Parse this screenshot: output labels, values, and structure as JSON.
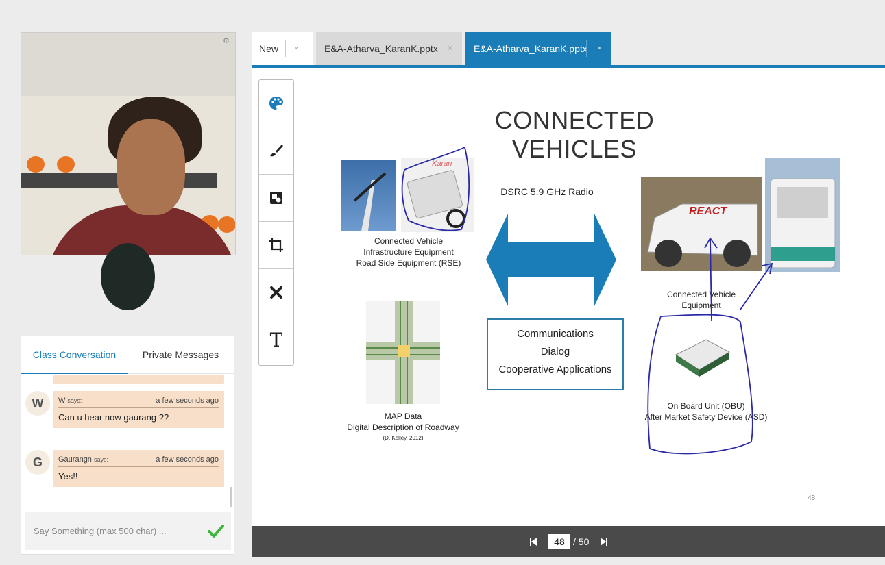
{
  "tabs": {
    "new_label": "New",
    "items": [
      {
        "label": "E&A-Atharva_KaranK.pptx",
        "close": "×"
      },
      {
        "label": "E&A-Atharva_KaranK.pptx",
        "close": "×"
      }
    ]
  },
  "slide": {
    "title": "CONNECTED VEHICLES",
    "rse_caption": [
      "Connected Vehicle",
      "Infrastructure Equipment",
      "Road Side Equipment (RSE)"
    ],
    "rse_watermark": "Karan",
    "dsrc_label": "DSRC 5.9 GHz Radio",
    "comm_box": [
      "Communications",
      "Dialog",
      "Cooperative Applications"
    ],
    "map_caption": [
      "MAP Data",
      "Digital Description of Roadway",
      "(D. Kelley, 2012)"
    ],
    "cve_caption": [
      "Connected Vehicle",
      "Equipment"
    ],
    "truck_logo": "REACT",
    "obu_caption": [
      "On Board Unit (OBU)",
      "After Market Safety Device (ASD)"
    ],
    "page_number": "48"
  },
  "pager": {
    "current": "48",
    "total": "/ 50"
  },
  "chat": {
    "tab_class": "Class Conversation",
    "tab_private": "Private Messages",
    "messages": [
      {
        "initial": "W",
        "name": "W",
        "says": "says:",
        "time": "a few seconds ago",
        "text": "Can u hear now gaurang ??"
      },
      {
        "initial": "G",
        "name": "Gaurangn",
        "says": "says:",
        "time": "a few seconds ago",
        "text": "Yes!!"
      }
    ],
    "input_placeholder": "Say Something (max 500 char) ..."
  },
  "colors": {
    "accent": "#1a7db7",
    "bubble": "#f7dfc9",
    "send": "#3fb53f",
    "annotation": "#2a2aa8"
  }
}
